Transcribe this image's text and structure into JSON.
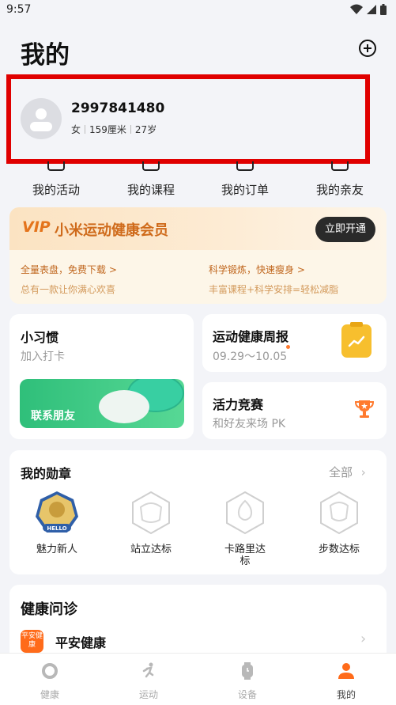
{
  "status_bar": {
    "time": "9:57"
  },
  "header": {
    "title": "我的"
  },
  "profile": {
    "user_id": "2997841480",
    "gender": "女",
    "height": "159厘米",
    "age": "27岁"
  },
  "quick_actions": [
    {
      "label": "我的活动",
      "icon": "flag-icon"
    },
    {
      "label": "我的课程",
      "icon": "video-icon"
    },
    {
      "label": "我的订单",
      "icon": "receipt-icon"
    },
    {
      "label": "我的亲友",
      "icon": "family-icon"
    }
  ],
  "vip": {
    "logo": "VIP",
    "name": "小米运动健康会员",
    "button": "立即开通",
    "left_title": "全量表盘，免费下载 >",
    "left_sub": "总有一款让你满心欢喜",
    "right_title": "科学锻炼，快速瘦身 >",
    "right_sub": "丰富课程+科学安排=轻松减脂"
  },
  "habit": {
    "title": "小习惯",
    "subtitle": "加入打卡",
    "banner": "联系朋友"
  },
  "report": {
    "title": "运动健康周报",
    "date_range": "09.29～10.05"
  },
  "challenge": {
    "title": "活力竞赛",
    "subtitle": "和好友来场 PK"
  },
  "medals": {
    "title": "我的勋章",
    "all": "全部",
    "items": [
      {
        "label": "魅力新人",
        "badge_text": "HELLO"
      },
      {
        "label": "站立达标"
      },
      {
        "label": "卡路里达标"
      },
      {
        "label": "步数达标"
      }
    ]
  },
  "health": {
    "title": "健康问诊",
    "item": "平安健康",
    "icon_text": "平安健康"
  },
  "tabbar": [
    {
      "label": "健康",
      "icon": "health-ring-icon"
    },
    {
      "label": "运动",
      "icon": "running-icon"
    },
    {
      "label": "设备",
      "icon": "watch-icon"
    },
    {
      "label": "我的",
      "icon": "person-icon",
      "active": true
    }
  ],
  "colors": {
    "accent": "#ff6b1a",
    "vip_orange": "#cf6a1a",
    "green": "#2fbf7a",
    "highlight_border": "#e00000"
  }
}
